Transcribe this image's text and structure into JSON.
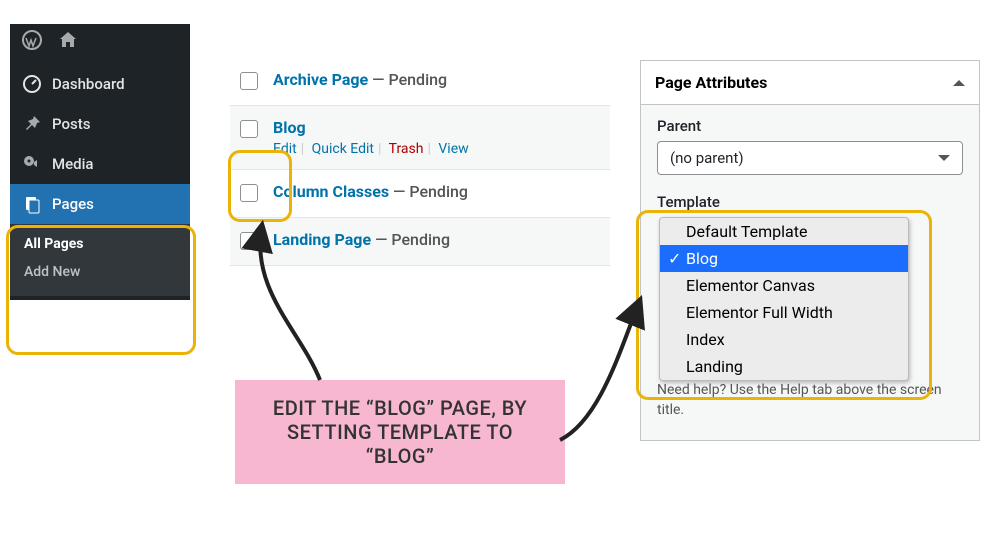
{
  "sidebar": {
    "items": [
      {
        "label": "Dashboard",
        "icon": "dashboard"
      },
      {
        "label": "Posts",
        "icon": "pin"
      },
      {
        "label": "Media",
        "icon": "media"
      },
      {
        "label": "Pages",
        "icon": "pages",
        "active": true
      }
    ],
    "submenu": [
      {
        "label": "All Pages",
        "current": true
      },
      {
        "label": "Add New"
      }
    ]
  },
  "pages": [
    {
      "title": "Archive Page",
      "status": "Pending",
      "actions": false
    },
    {
      "title": "Blog",
      "status": "",
      "actions": true
    },
    {
      "title": "Column Classes",
      "status": "Pending",
      "actions": false
    },
    {
      "title": "Landing Page",
      "status": "Pending",
      "actions": false
    }
  ],
  "row_actions": {
    "edit": "Edit",
    "quick": "Quick Edit",
    "trash": "Trash",
    "view": "View"
  },
  "metabox": {
    "title": "Page Attributes",
    "parent_label": "Parent",
    "parent_value": "(no parent)",
    "template_label": "Template",
    "template_options": [
      "Default Template",
      "Blog",
      "Elementor Canvas",
      "Elementor Full Width",
      "Index",
      "Landing"
    ],
    "template_selected": "Blog",
    "help": "Need help? Use the Help tab above the screen title."
  },
  "annotation": {
    "note": "EDIT THE “BLOG” PAGE, BY SETTING TEMPLATE TO “BLOG”"
  },
  "dash": " — "
}
